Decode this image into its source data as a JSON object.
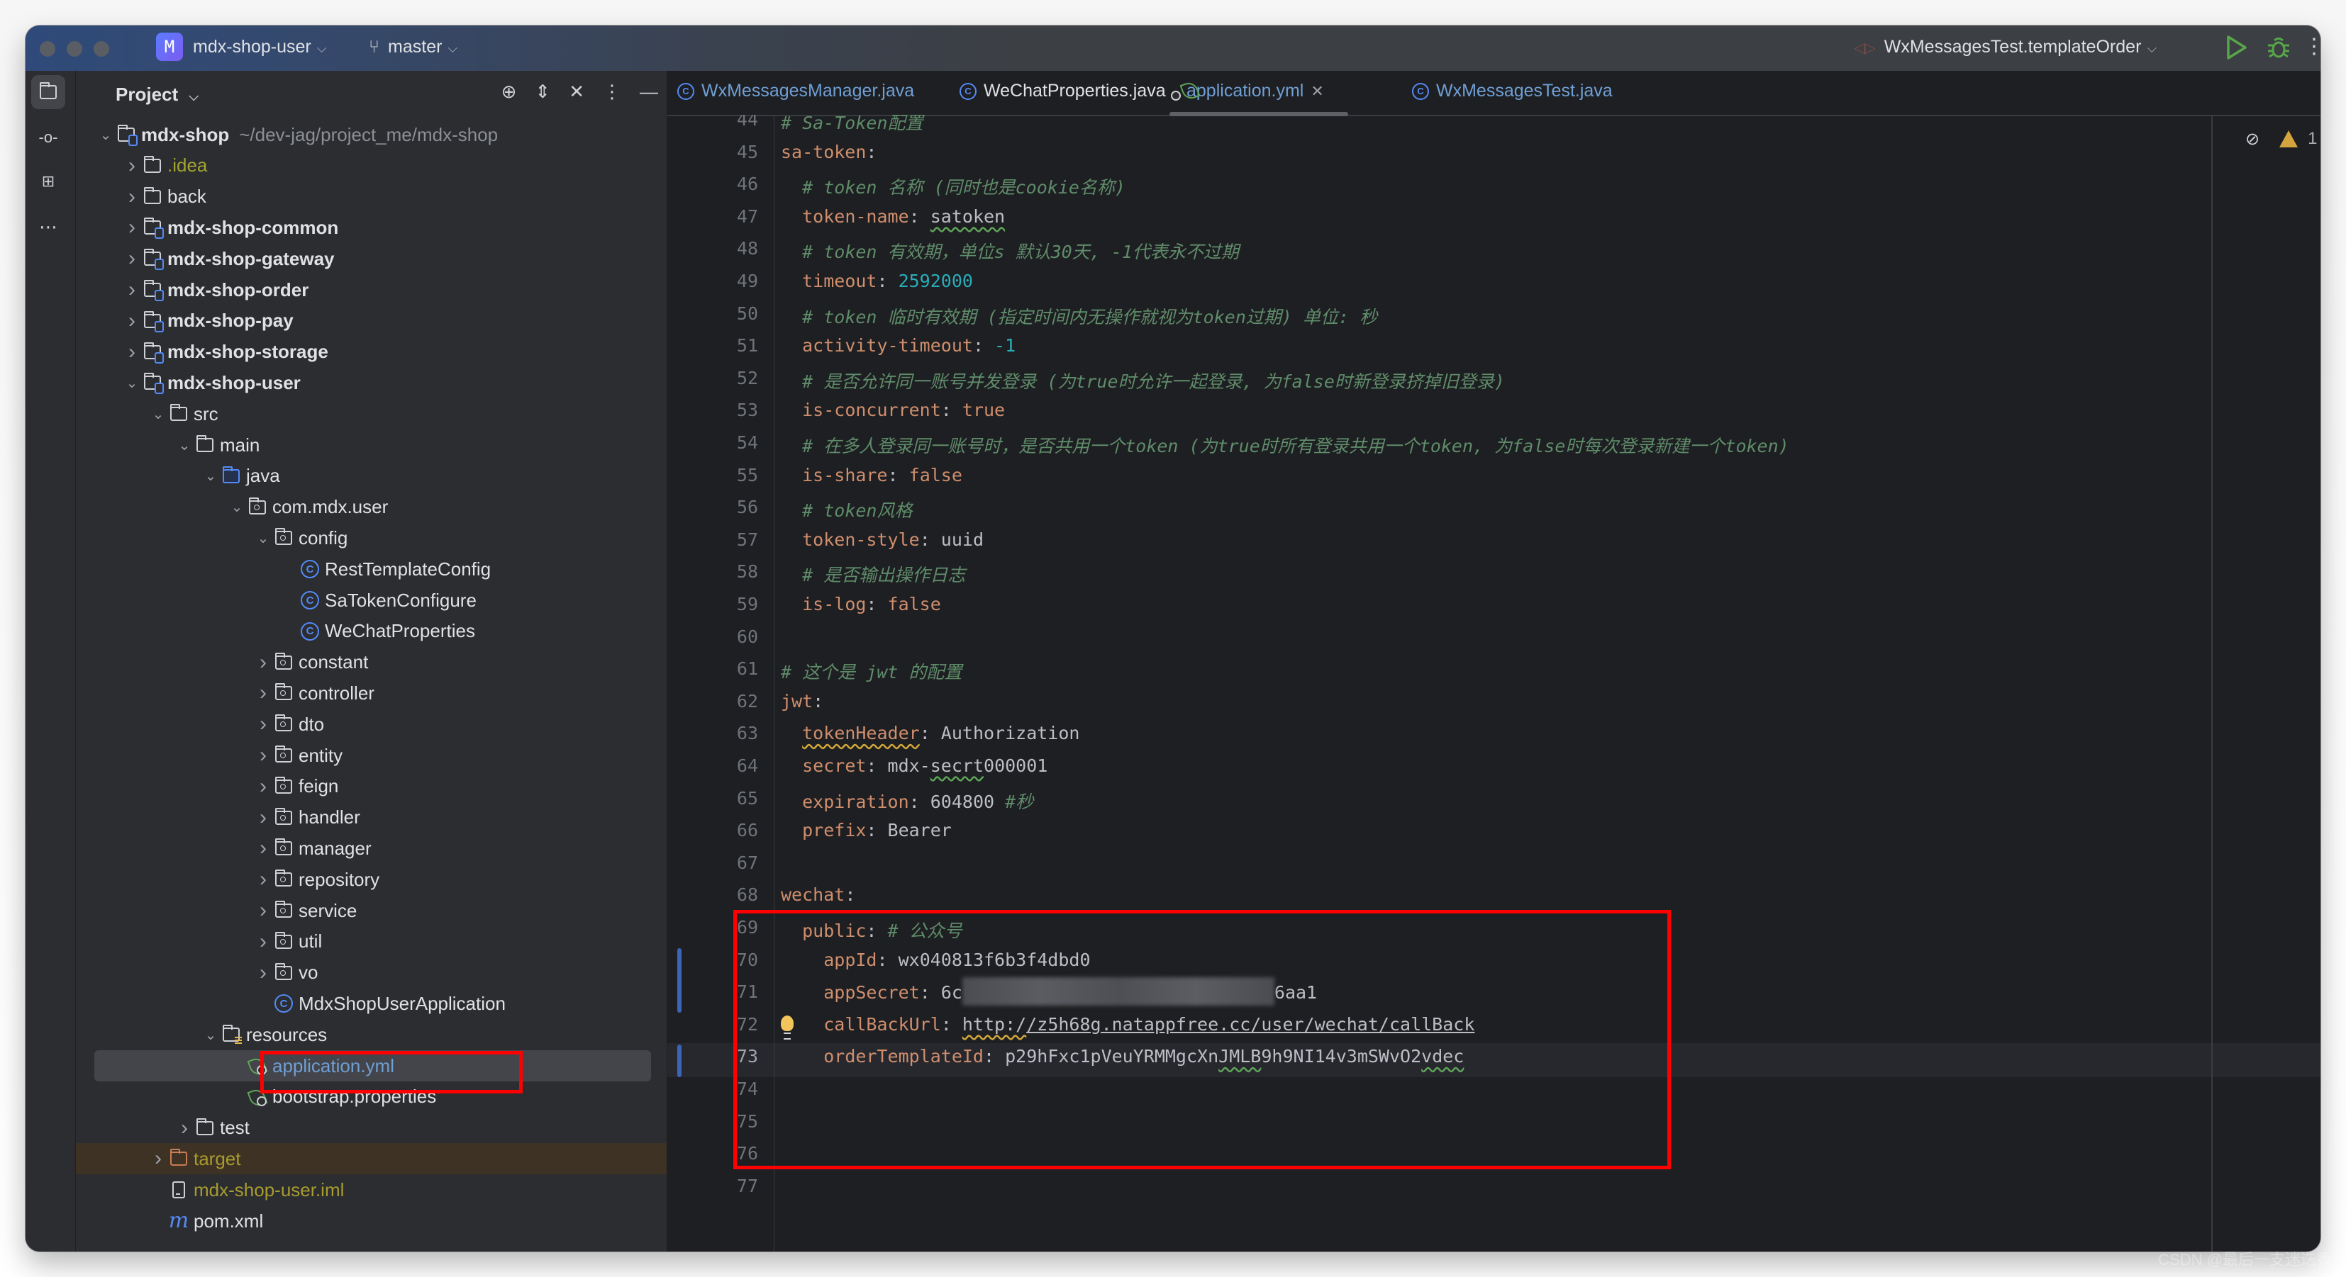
{
  "titlebar": {
    "project_badge": "M",
    "project_name": "mdx-shop-user",
    "branch": "master",
    "run_config": "WxMessagesTest.templateOrder"
  },
  "toolstrip": {
    "items": [
      "project-icon",
      "commit-icon",
      "structure-icon",
      "more-icon"
    ]
  },
  "panel": {
    "title": "Project",
    "tools": [
      "locate-icon",
      "expand-all-icon",
      "collapse-all-icon",
      "options-icon",
      "hide-icon"
    ]
  },
  "tree": [
    {
      "label": "mdx-shop",
      "hint": "~/dev-jag/project_me/mdx-shop",
      "depth": 0,
      "expanded": true,
      "icon": "module",
      "bold": true
    },
    {
      "label": ".idea",
      "depth": 1,
      "expanded": false,
      "icon": "folder",
      "color": "idea"
    },
    {
      "label": "back",
      "depth": 1,
      "expanded": false,
      "icon": "folder"
    },
    {
      "label": "mdx-shop-common",
      "depth": 1,
      "expanded": false,
      "icon": "module",
      "bold": true
    },
    {
      "label": "mdx-shop-gateway",
      "depth": 1,
      "expanded": false,
      "icon": "module",
      "bold": true
    },
    {
      "label": "mdx-shop-order",
      "depth": 1,
      "expanded": false,
      "icon": "module",
      "bold": true
    },
    {
      "label": "mdx-shop-pay",
      "depth": 1,
      "expanded": false,
      "icon": "module",
      "bold": true
    },
    {
      "label": "mdx-shop-storage",
      "depth": 1,
      "expanded": false,
      "icon": "module",
      "bold": true
    },
    {
      "label": "mdx-shop-user",
      "depth": 1,
      "expanded": true,
      "icon": "module",
      "bold": true
    },
    {
      "label": "src",
      "depth": 2,
      "expanded": true,
      "icon": "folder"
    },
    {
      "label": "main",
      "depth": 3,
      "expanded": true,
      "icon": "folder"
    },
    {
      "label": "java",
      "depth": 4,
      "expanded": true,
      "icon": "source-folder"
    },
    {
      "label": "com.mdx.user",
      "depth": 5,
      "expanded": true,
      "icon": "package"
    },
    {
      "label": "config",
      "depth": 6,
      "expanded": true,
      "icon": "package"
    },
    {
      "label": "RestTemplateConfig",
      "depth": 7,
      "icon": "class"
    },
    {
      "label": "SaTokenConfigure",
      "depth": 7,
      "icon": "class"
    },
    {
      "label": "WeChatProperties",
      "depth": 7,
      "icon": "class"
    },
    {
      "label": "constant",
      "depth": 6,
      "expanded": false,
      "icon": "package"
    },
    {
      "label": "controller",
      "depth": 6,
      "expanded": false,
      "icon": "package"
    },
    {
      "label": "dto",
      "depth": 6,
      "expanded": false,
      "icon": "package"
    },
    {
      "label": "entity",
      "depth": 6,
      "expanded": false,
      "icon": "package"
    },
    {
      "label": "feign",
      "depth": 6,
      "expanded": false,
      "icon": "package"
    },
    {
      "label": "handler",
      "depth": 6,
      "expanded": false,
      "icon": "package"
    },
    {
      "label": "manager",
      "depth": 6,
      "expanded": false,
      "icon": "package"
    },
    {
      "label": "repository",
      "depth": 6,
      "expanded": false,
      "icon": "package"
    },
    {
      "label": "service",
      "depth": 6,
      "expanded": false,
      "icon": "package"
    },
    {
      "label": "util",
      "depth": 6,
      "expanded": false,
      "icon": "package"
    },
    {
      "label": "vo",
      "depth": 6,
      "expanded": false,
      "icon": "package"
    },
    {
      "label": "MdxShopUserApplication",
      "depth": 6,
      "icon": "spring-class"
    },
    {
      "label": "resources",
      "depth": 4,
      "expanded": true,
      "icon": "resources-folder"
    },
    {
      "label": "application.yml",
      "depth": 5,
      "icon": "spring-config",
      "selected": true,
      "color": "link"
    },
    {
      "label": "bootstrap.properties",
      "depth": 5,
      "icon": "spring-config"
    },
    {
      "label": "test",
      "depth": 3,
      "expanded": false,
      "icon": "folder"
    },
    {
      "label": "target",
      "depth": 2,
      "expanded": false,
      "icon": "excluded-folder",
      "color": "excl",
      "excluded": true
    },
    {
      "label": "mdx-shop-user.iml",
      "depth": 2,
      "icon": "iml",
      "color": "excl"
    },
    {
      "label": "pom.xml",
      "depth": 2,
      "icon": "maven"
    }
  ],
  "tabs": [
    {
      "label": "WxMessagesManager.java",
      "icon": "class",
      "active": false
    },
    {
      "label": "WeChatProperties.java",
      "icon": "class",
      "active": false
    },
    {
      "label": "application.yml",
      "icon": "spring-config",
      "active": true,
      "closable": true
    },
    {
      "label": "WxMessagesTest.java",
      "icon": "class",
      "active": false
    }
  ],
  "editor": {
    "inspections": {
      "warnings": "1",
      "weak_warnings": "1"
    },
    "current_line": 73,
    "lines": [
      {
        "n": 44,
        "t": [
          [
            "cm",
            "# Sa-Token配置"
          ]
        ]
      },
      {
        "n": 45,
        "t": [
          [
            "k",
            "sa-token"
          ],
          [
            "v",
            ":"
          ]
        ]
      },
      {
        "n": 46,
        "t": [
          [
            "v",
            "  "
          ],
          [
            "cm",
            "# token 名称 (同时也是cookie名称)"
          ]
        ]
      },
      {
        "n": 47,
        "t": [
          [
            "v",
            "  "
          ],
          [
            "k",
            "token-name"
          ],
          [
            "v",
            ": "
          ],
          [
            "v squig-g",
            "satoken"
          ]
        ]
      },
      {
        "n": 48,
        "t": [
          [
            "v",
            "  "
          ],
          [
            "cm",
            "# token 有效期，单位s 默认30天, -1代表永不过期"
          ]
        ]
      },
      {
        "n": 49,
        "t": [
          [
            "v",
            "  "
          ],
          [
            "k",
            "timeout"
          ],
          [
            "v",
            ": "
          ],
          [
            "num",
            "2592000"
          ]
        ]
      },
      {
        "n": 50,
        "t": [
          [
            "v",
            "  "
          ],
          [
            "cm",
            "# token 临时有效期 (指定时间内无操作就视为token过期) 单位: 秒"
          ]
        ]
      },
      {
        "n": 51,
        "t": [
          [
            "v",
            "  "
          ],
          [
            "k",
            "activity-timeout"
          ],
          [
            "v",
            ": "
          ],
          [
            "num",
            "-1"
          ]
        ]
      },
      {
        "n": 52,
        "t": [
          [
            "v",
            "  "
          ],
          [
            "cm",
            "# 是否允许同一账号并发登录 (为true时允许一起登录, 为false时新登录挤掉旧登录)"
          ]
        ]
      },
      {
        "n": 53,
        "t": [
          [
            "v",
            "  "
          ],
          [
            "k",
            "is-concurrent"
          ],
          [
            "v",
            ": "
          ],
          [
            "k",
            "true"
          ]
        ]
      },
      {
        "n": 54,
        "t": [
          [
            "v",
            "  "
          ],
          [
            "cm",
            "# 在多人登录同一账号时，是否共用一个token (为true时所有登录共用一个token, 为false时每次登录新建一个token)"
          ]
        ]
      },
      {
        "n": 55,
        "t": [
          [
            "v",
            "  "
          ],
          [
            "k",
            "is-share"
          ],
          [
            "v",
            ": "
          ],
          [
            "k",
            "false"
          ]
        ]
      },
      {
        "n": 56,
        "t": [
          [
            "v",
            "  "
          ],
          [
            "cm",
            "# token风格"
          ]
        ]
      },
      {
        "n": 57,
        "t": [
          [
            "v",
            "  "
          ],
          [
            "k",
            "token-style"
          ],
          [
            "v",
            ": "
          ],
          [
            "v",
            "uuid"
          ]
        ]
      },
      {
        "n": 58,
        "t": [
          [
            "v",
            "  "
          ],
          [
            "cm",
            "# 是否输出操作日志"
          ]
        ]
      },
      {
        "n": 59,
        "t": [
          [
            "v",
            "  "
          ],
          [
            "k",
            "is-log"
          ],
          [
            "v",
            ": "
          ],
          [
            "k",
            "false"
          ]
        ]
      },
      {
        "n": 60,
        "t": []
      },
      {
        "n": 61,
        "t": [
          [
            "cm",
            "# 这个是 jwt 的配置"
          ]
        ]
      },
      {
        "n": 62,
        "t": [
          [
            "k",
            "jwt"
          ],
          [
            "v",
            ":"
          ]
        ]
      },
      {
        "n": 63,
        "t": [
          [
            "v",
            "  "
          ],
          [
            "k squig-y",
            "tokenHeader"
          ],
          [
            "v",
            ": "
          ],
          [
            "v",
            "Authorization"
          ]
        ]
      },
      {
        "n": 64,
        "t": [
          [
            "v",
            "  "
          ],
          [
            "k",
            "secret"
          ],
          [
            "v",
            ": "
          ],
          [
            "v",
            "mdx-"
          ],
          [
            "v squig-g",
            "secrt"
          ],
          [
            "v",
            "000001"
          ]
        ]
      },
      {
        "n": 65,
        "t": [
          [
            "v",
            "  "
          ],
          [
            "k",
            "expiration"
          ],
          [
            "v",
            ": "
          ],
          [
            "v",
            "604800 "
          ],
          [
            "cm",
            "#秒"
          ]
        ]
      },
      {
        "n": 66,
        "t": [
          [
            "v",
            "  "
          ],
          [
            "k",
            "prefix"
          ],
          [
            "v",
            ": "
          ],
          [
            "v",
            "Bearer"
          ]
        ]
      },
      {
        "n": 67,
        "t": []
      },
      {
        "n": 68,
        "t": [
          [
            "k",
            "wechat"
          ],
          [
            "v",
            ":"
          ]
        ]
      },
      {
        "n": 69,
        "t": [
          [
            "v",
            "  "
          ],
          [
            "k",
            "public"
          ],
          [
            "v",
            ": "
          ],
          [
            "cm",
            "# 公众号"
          ]
        ]
      },
      {
        "n": 70,
        "t": [
          [
            "v",
            "    "
          ],
          [
            "k",
            "appId"
          ],
          [
            "v",
            ": "
          ],
          [
            "v",
            "wx040813f6b3f4dbd0"
          ]
        ]
      },
      {
        "n": 71,
        "t": [
          [
            "v",
            "    "
          ],
          [
            "k",
            "appSecret"
          ],
          [
            "v",
            ": "
          ],
          [
            "v",
            "6c"
          ],
          [
            "blur",
            ""
          ],
          [
            "v",
            "6aa1"
          ]
        ]
      },
      {
        "n": 72,
        "t": [
          [
            "v",
            "    "
          ],
          [
            "k",
            "callBackUrl"
          ],
          [
            "v",
            ": "
          ],
          [
            "v url squig-y",
            "http:/"
          ],
          [
            "v url",
            "/z5h68g.natappfree.cc/user/wechat/callBack"
          ]
        ]
      },
      {
        "n": 73,
        "t": [
          [
            "v",
            "    "
          ],
          [
            "k",
            "orderTemplateId"
          ],
          [
            "v",
            ": "
          ],
          [
            "v",
            "p29hFxc1pVeuYRMMgcXn"
          ],
          [
            "v squig-g",
            "JMLB"
          ],
          [
            "v",
            "9h9NI14v3mSWvO2"
          ],
          [
            "v squig-g",
            "vdec"
          ]
        ]
      },
      {
        "n": 74,
        "t": []
      },
      {
        "n": 75,
        "t": []
      },
      {
        "n": 76,
        "t": []
      },
      {
        "n": 77,
        "t": []
      }
    ]
  },
  "watermark": "CSDN @最后一支迷迭香"
}
